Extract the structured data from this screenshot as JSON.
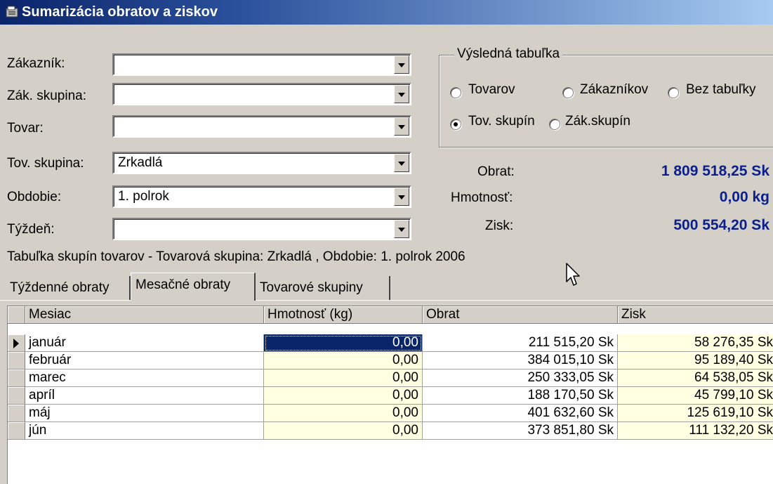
{
  "window": {
    "title": "Sumarizácia obratov a ziskov",
    "icon": "app-icon"
  },
  "filters": [
    {
      "label": "Zákazník:",
      "value": ""
    },
    {
      "label": "Zák. skupina:",
      "value": ""
    },
    {
      "label": "Tovar:",
      "value": ""
    },
    {
      "label": "Tov. skupina:",
      "value": "Zrkadlá"
    },
    {
      "label": "Obdobie:",
      "value": "1. polrok"
    },
    {
      "label": "Týždeň:",
      "value": ""
    }
  ],
  "result_table": {
    "title": "Výsledná tabuľka",
    "options": [
      {
        "label": "Tovarov",
        "selected": false
      },
      {
        "label": "Zákazníkov",
        "selected": false
      },
      {
        "label": "Bez tabuľky",
        "selected": false
      },
      {
        "label": "Tov. skupín",
        "selected": true
      },
      {
        "label": "Zák.skupín",
        "selected": false
      }
    ]
  },
  "summary": {
    "obrat_label": "Obrat:",
    "obrat_value": "1 809 518,25 Sk",
    "hmotnost_label": "Hmotnosť:",
    "hmotnost_value": "0,00 kg",
    "zisk_label": "Zisk:",
    "zisk_value": "500 554,20 Sk"
  },
  "status_text": "Tabuľka skupín tovarov - Tovarová skupina: Zrkadlá , Obdobie: 1. polrok 2006",
  "tabs": [
    {
      "label": "Týždenné obraty",
      "active": false
    },
    {
      "label": "Mesačné obraty",
      "active": true
    },
    {
      "label": "Tovarové skupiny",
      "active": false
    }
  ],
  "grid": {
    "columns": [
      "Mesiac",
      "Hmotnosť (kg)",
      "Obrat",
      "Zisk"
    ],
    "rows": [
      [
        "január",
        "0,00",
        "211 515,20 Sk",
        "58 276,35 Sk"
      ],
      [
        "február",
        "0,00",
        "384 015,10 Sk",
        "95 189,40 Sk"
      ],
      [
        "marec",
        "0,00",
        "250 333,05 Sk",
        "64 538,05 Sk"
      ],
      [
        "apríl",
        "0,00",
        "188 170,50 Sk",
        "45 799,10 Sk"
      ],
      [
        "máj",
        "0,00",
        "401 632,60 Sk",
        "125 619,10 Sk"
      ],
      [
        "jún",
        "0,00",
        "373 851,80 Sk",
        "111 132,20 Sk"
      ]
    ],
    "selected_row": 0
  },
  "colors": {
    "title_start": "#0a246a",
    "title_end": "#a6caf0",
    "summary_value": "#0a1e8c",
    "cell_highlight": "#ffffe1"
  }
}
